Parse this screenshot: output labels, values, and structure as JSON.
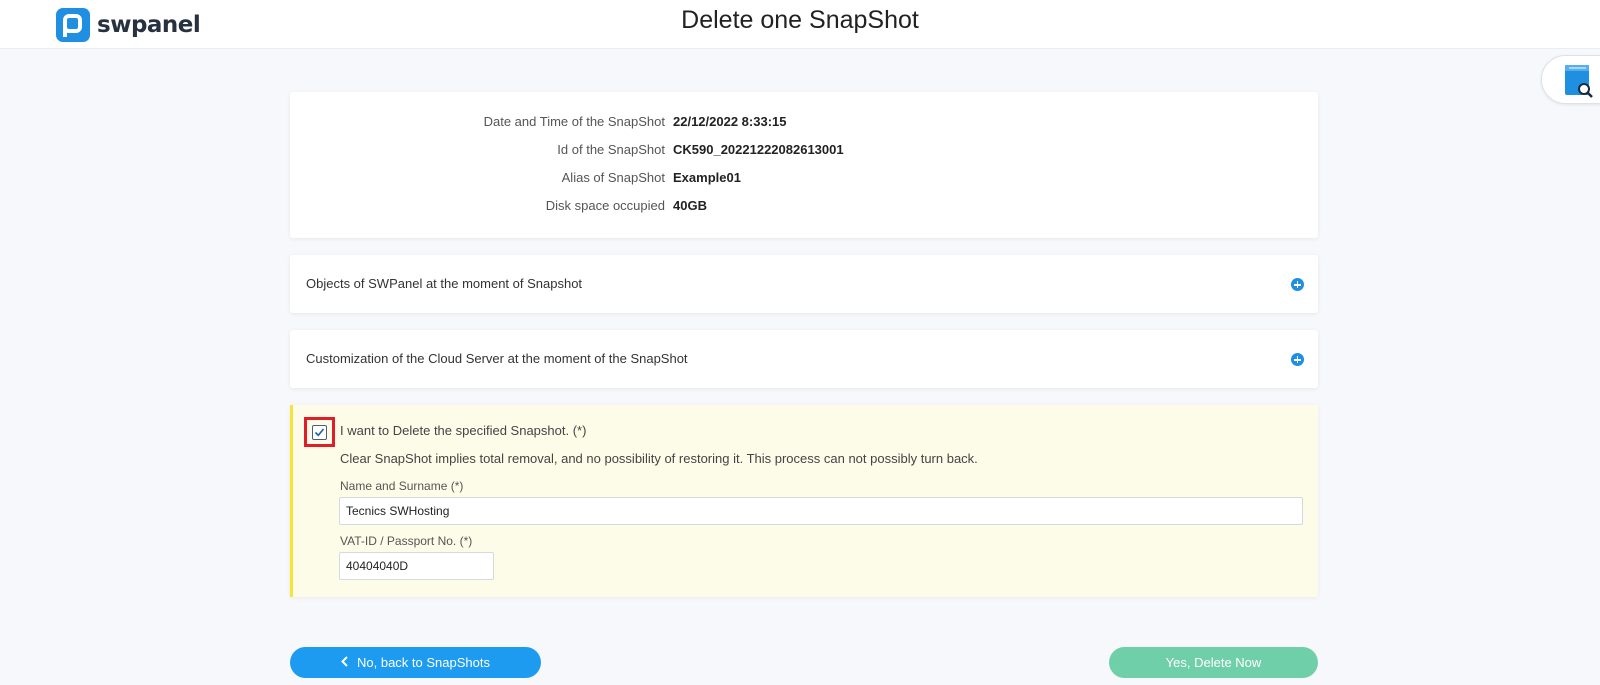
{
  "app": {
    "logo_text": "swpanel",
    "page_title": "Delete one SnapShot"
  },
  "snapshot_info": [
    {
      "label": "Date and Time of the SnapShot",
      "value": "22/12/2022 8:33:15"
    },
    {
      "label": "Id of the SnapShot",
      "value": "CK590_20221222082613001"
    },
    {
      "label": "Alias of SnapShot",
      "value": "Example01"
    },
    {
      "label": "Disk space occupied",
      "value": "40GB"
    }
  ],
  "accordions": [
    {
      "title": "Objects of SWPanel at the moment of Snapshot",
      "icon": "plus-circle-icon"
    },
    {
      "title": "Customization of the Cloud Server at the moment of the SnapShot",
      "icon": "plus-circle-icon"
    }
  ],
  "confirm": {
    "checked": true,
    "label": "I want to Delete the specified Snapshot.  (*)",
    "warning": "Clear SnapShot implies total removal, and no possibility of restoring it. This process can not possibly turn back.",
    "name_label": "Name and Surname (*)",
    "name_value": "Tecnics SWHosting",
    "vat_label": "VAT-ID / Passport No. (*)",
    "vat_value": "40404040D"
  },
  "actions": {
    "back_label": "No, back to SnapShots",
    "delete_label": "Yes, Delete Now"
  },
  "colors": {
    "brand": "#1e8fe1",
    "back_button": "#1d9bf0",
    "delete_button": "#6fcfa9",
    "confirm_panel_bg": "#fdfce9",
    "confirm_panel_accent": "#f7e43b",
    "highlight": "#e21d25"
  }
}
